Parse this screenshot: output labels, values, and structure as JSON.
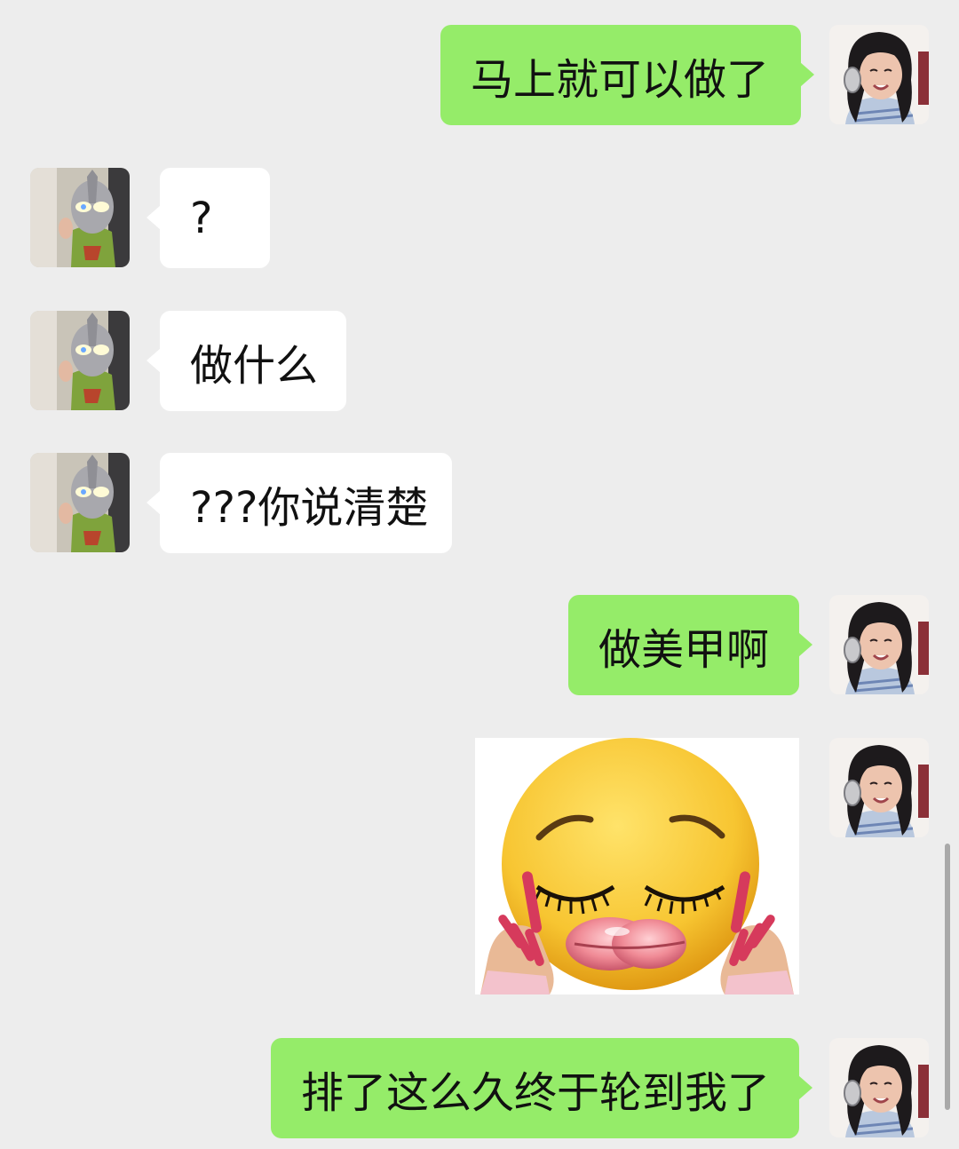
{
  "messages": [
    {
      "sender": "me",
      "type": "text",
      "text": "马上就可以做了"
    },
    {
      "sender": "other",
      "type": "text",
      "text": "?"
    },
    {
      "sender": "other",
      "type": "text",
      "text": "做什么"
    },
    {
      "sender": "other",
      "type": "text",
      "text": "???你说清楚"
    },
    {
      "sender": "me",
      "type": "text",
      "text": "做美甲啊"
    },
    {
      "sender": "me",
      "type": "sticker",
      "sticker_icon": "pleading-lips-nails-face-sticker"
    },
    {
      "sender": "me",
      "type": "text",
      "text": "排了这么久终于轮到我了"
    }
  ],
  "colors": {
    "background": "#ededed",
    "my_bubble": "#95ec69",
    "other_bubble": "#ffffff",
    "text": "#111111"
  },
  "icons": {
    "my_avatar": "girl-with-headphones-avatar",
    "other_avatar": "ultraman-mask-avatar"
  }
}
